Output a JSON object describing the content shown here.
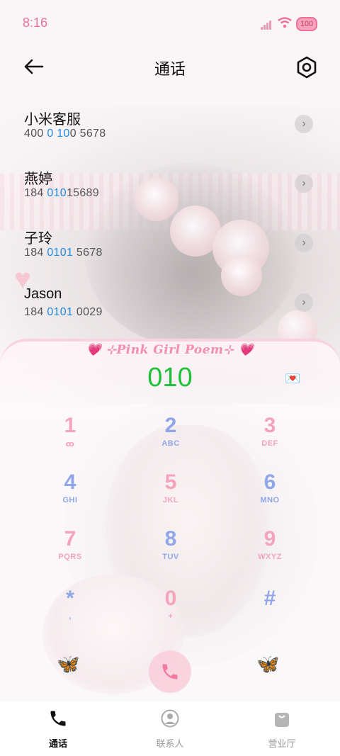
{
  "status_bar": {
    "time": "8:16",
    "battery": "100"
  },
  "header": {
    "title": "通话"
  },
  "contacts": [
    {
      "name": "小米客服",
      "number_pre": "400 ",
      "number_hl": "0 10",
      "number_post": "0 5678"
    },
    {
      "name": "燕婷",
      "number_pre": "184 ",
      "number_hl": "010",
      "number_post": "15689"
    },
    {
      "name": "子玲",
      "number_pre": "184 ",
      "number_hl": "0101",
      "number_post": " 5678"
    },
    {
      "name": "Jason",
      "number_pre": "184 ",
      "number_hl": "0101",
      "number_post": " 0029"
    }
  ],
  "dialpad": {
    "banner": "💗 ⊹Pink Girl Poem⊹ 💗",
    "display_number": "010",
    "keys": [
      {
        "digit": "1",
        "letters": "ꝏ",
        "color": "pink"
      },
      {
        "digit": "2",
        "letters": "ABC",
        "color": "blue"
      },
      {
        "digit": "3",
        "letters": "DEF",
        "color": "pink"
      },
      {
        "digit": "4",
        "letters": "GHI",
        "color": "blue"
      },
      {
        "digit": "5",
        "letters": "JKL",
        "color": "pink"
      },
      {
        "digit": "6",
        "letters": "MNO",
        "color": "blue"
      },
      {
        "digit": "7",
        "letters": "PQRS",
        "color": "pink"
      },
      {
        "digit": "8",
        "letters": "TUV",
        "color": "blue"
      },
      {
        "digit": "9",
        "letters": "WXYZ",
        "color": "pink"
      },
      {
        "digit": "*",
        "letters": ",",
        "color": "blue"
      },
      {
        "digit": "0",
        "letters": "+",
        "color": "pink"
      },
      {
        "digit": "#",
        "letters": "",
        "color": "blue"
      }
    ]
  },
  "bottom_nav": [
    {
      "label": "通话",
      "icon": "phone-icon",
      "active": true
    },
    {
      "label": "联系人",
      "icon": "contact-icon",
      "active": false
    },
    {
      "label": "营业厅",
      "icon": "shop-bag-icon",
      "active": false
    }
  ],
  "colors": {
    "accent_pink": "#f4a3bd",
    "accent_blue": "#8fa6e8",
    "highlight": "#1e8be6",
    "display_green": "#1fbf3a"
  }
}
